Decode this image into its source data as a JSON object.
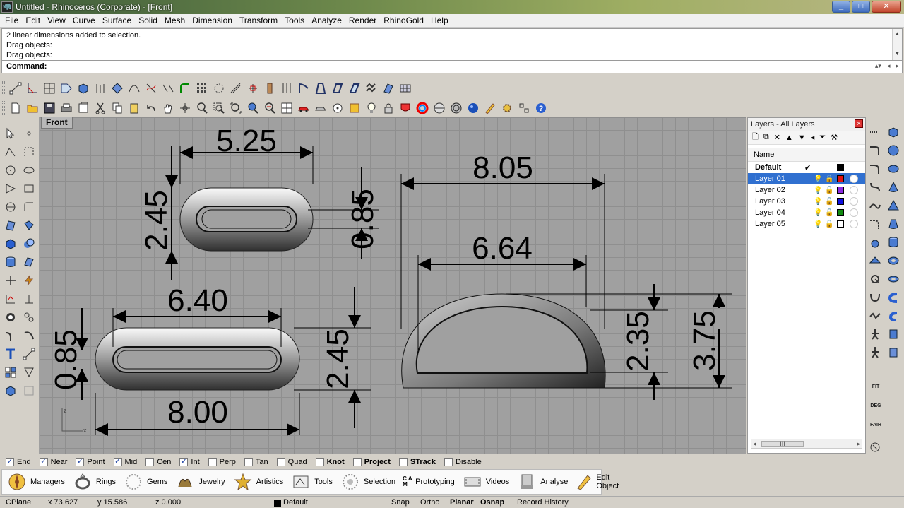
{
  "window": {
    "title": "Untitled - Rhinoceros (Corporate) - [Front]",
    "buttons": [
      "_",
      "□",
      "✕"
    ]
  },
  "menu": [
    "File",
    "Edit",
    "View",
    "Curve",
    "Surface",
    "Solid",
    "Mesh",
    "Dimension",
    "Transform",
    "Tools",
    "Analyze",
    "Render",
    "RhinoGold",
    "Help"
  ],
  "command_history": [
    "2 linear dimensions added to selection.",
    "Drag objects:",
    "Drag objects:"
  ],
  "command_prompt": "Command:",
  "viewport": {
    "name": "Front",
    "axis_labels": {
      "z": "z",
      "x": "x"
    },
    "dimensions": {
      "top_oval_width": "5.25",
      "top_oval_height": "2.45",
      "top_oval_inner": "0.85",
      "bottom_oval_inner_width": "6.40",
      "bottom_oval_inner": "0.85",
      "bottom_oval_height": "2.45",
      "bottom_oval_width": "8.00",
      "dring_outer_width": "8.05",
      "dring_inner_width": "6.64",
      "dring_inner_height": "2.35",
      "dring_outer_height": "3.75"
    }
  },
  "layers_panel": {
    "title": "Layers - All Layers",
    "column_name": "Name",
    "layers": [
      {
        "name": "Default",
        "current": "✔",
        "color": "#000000",
        "selected": false
      },
      {
        "name": "Layer 01",
        "current": "",
        "color": "#e01010",
        "selected": true
      },
      {
        "name": "Layer 02",
        "current": "",
        "color": "#8a2be2",
        "selected": false
      },
      {
        "name": "Layer 03",
        "current": "",
        "color": "#1010e0",
        "selected": false
      },
      {
        "name": "Layer 04",
        "current": "",
        "color": "#108a10",
        "selected": false
      },
      {
        "name": "Layer 05",
        "current": "",
        "color": "#ffffff",
        "selected": false
      }
    ],
    "scroll_thumb": "III"
  },
  "right_palette_text": [
    "FIT",
    "DEG",
    "FAIR"
  ],
  "osnap": [
    {
      "label": "End",
      "checked": true,
      "bold": false
    },
    {
      "label": "Near",
      "checked": true,
      "bold": false
    },
    {
      "label": "Point",
      "checked": true,
      "bold": false
    },
    {
      "label": "Mid",
      "checked": true,
      "bold": false
    },
    {
      "label": "Cen",
      "checked": false,
      "bold": false
    },
    {
      "label": "Int",
      "checked": true,
      "bold": false
    },
    {
      "label": "Perp",
      "checked": false,
      "bold": false
    },
    {
      "label": "Tan",
      "checked": false,
      "bold": false
    },
    {
      "label": "Quad",
      "checked": false,
      "bold": false
    },
    {
      "label": "Knot",
      "checked": false,
      "bold": false
    },
    {
      "label": "Project",
      "checked": false,
      "bold": false
    },
    {
      "label": "STrack",
      "checked": false,
      "bold": false
    },
    {
      "label": "Disable",
      "checked": false,
      "bold": false
    }
  ],
  "rhinogold_bar": [
    {
      "label": "Managers",
      "icon": "compass-icon"
    },
    {
      "label": "Rings",
      "icon": "ring-icon"
    },
    {
      "label": "Gems",
      "icon": "gem-icon"
    },
    {
      "label": "Jewelry",
      "icon": "jewelry-icon"
    },
    {
      "label": "Artistics",
      "icon": "artistics-icon"
    },
    {
      "label": "Tools",
      "icon": "tools-icon"
    },
    {
      "label": "Selection",
      "icon": "selection-icon"
    },
    {
      "label": "Prototyping",
      "icon": "cam-icon",
      "icon_text": "C A M"
    },
    {
      "label": "Videos",
      "icon": "video-icon"
    },
    {
      "label": "Analyse",
      "icon": "analyse-icon"
    },
    {
      "label": "Edit Object",
      "icon": "edit-object-icon"
    }
  ],
  "status_bar": {
    "cplane": "CPlane",
    "x": "x 73.627",
    "y": "y 15.586",
    "z": "z 0.000",
    "layer": "Default",
    "snap": "Snap",
    "ortho": "Ortho",
    "planar": "Planar",
    "osnap": "Osnap",
    "record": "Record History"
  }
}
